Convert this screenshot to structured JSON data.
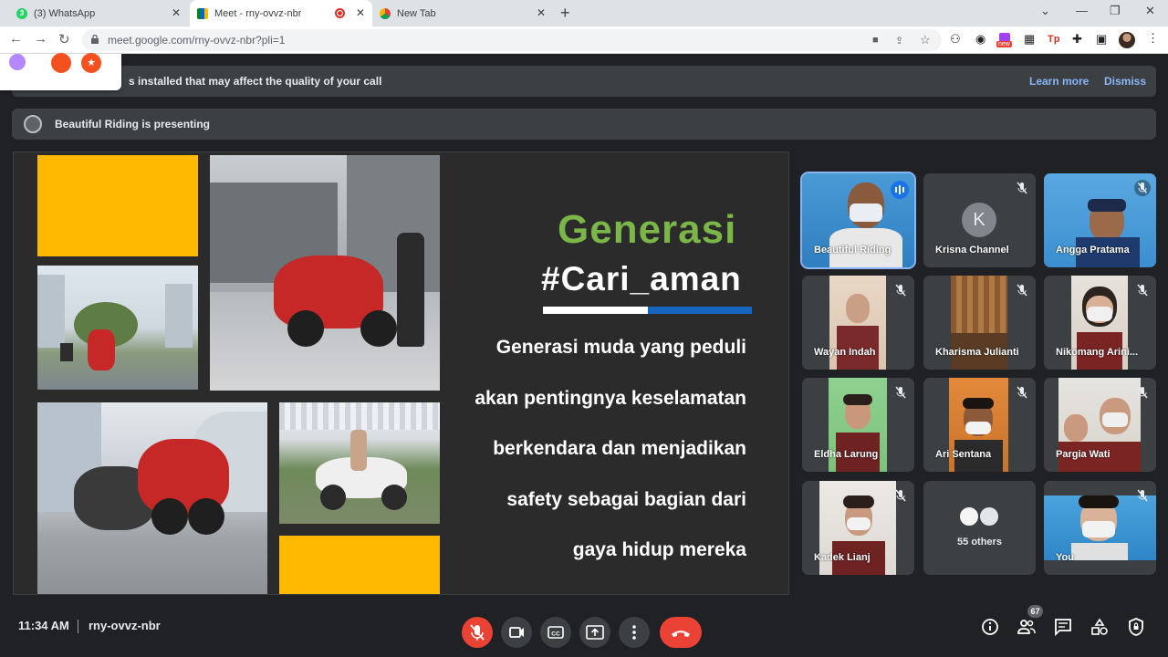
{
  "browser": {
    "tabs": [
      {
        "label": "(3) WhatsApp",
        "badge": "3"
      },
      {
        "label": "Meet - rny-ovvz-nbr"
      },
      {
        "label": "New Tab"
      }
    ],
    "url": "meet.google.com/rny-ovvz-nbr?pli=1",
    "ext_new_badge": "new",
    "ext_tp_label": "Tp"
  },
  "banner": {
    "message": "s installed that may affect the quality of your call",
    "learn_more": "Learn more",
    "dismiss": "Dismiss"
  },
  "presenting": {
    "text": "Beautiful Riding is presenting"
  },
  "slide": {
    "title": "Generasi",
    "hashtag": "#Cari_aman",
    "lines": [
      "Generasi muda yang peduli",
      "akan pentingnya keselamatan",
      "berkendara dan menjadikan",
      "safety sebagai bagian dari",
      "gaya hidup mereka"
    ]
  },
  "participants": [
    {
      "name": "Beautiful Riding",
      "state": "speaking"
    },
    {
      "name": "Krisna Channel",
      "initial": "K",
      "state": "muted"
    },
    {
      "name": "Angga Pratama",
      "state": "muted"
    },
    {
      "name": "Wayan Indah",
      "state": "muted"
    },
    {
      "name": "Kharisma Julianti",
      "state": "muted"
    },
    {
      "name": "Nikomang Arini...",
      "state": "muted"
    },
    {
      "name": "Eldha Larung",
      "state": "muted"
    },
    {
      "name": "Ari Sentana",
      "state": "muted"
    },
    {
      "name": "Pargia Wati",
      "state": "muted"
    },
    {
      "name": "Kadek Lianj",
      "state": "muted"
    },
    {
      "name": "55 others"
    },
    {
      "name": "You",
      "state": "muted"
    }
  ],
  "bottom": {
    "time": "11:34 AM",
    "meeting_code": "rny-ovvz-nbr",
    "participant_count": "67"
  },
  "colors": {
    "meet_bg": "#202124",
    "surface": "#3c4043",
    "accent_blue": "#8ab4f8",
    "danger_red": "#ea4335",
    "slide_green": "#7ab648",
    "slide_yellow": "#ffb900"
  }
}
